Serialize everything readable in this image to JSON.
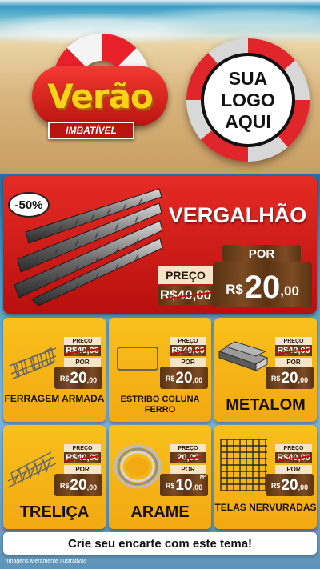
{
  "header": {
    "badge_title": "Verão",
    "badge_subtitle": "IMBATÍVEL",
    "logo_lines": [
      "SUA",
      "LOGO",
      "AQUI"
    ]
  },
  "featured": {
    "discount": "-50%",
    "name": "VERGALHÃO",
    "old_label": "PREÇO",
    "old_price": "R$40,00",
    "new_label": "POR",
    "currency": "R$",
    "price_int": "20",
    "price_dec": ",00"
  },
  "products": [
    {
      "name": "FERRAGEM ARMADA",
      "old_label": "PREÇO",
      "old_price": "R$40,00",
      "new_label": "POR",
      "currency": "R$",
      "price_int": "20",
      "price_dec": ",00",
      "unit": ""
    },
    {
      "name": "ESTRIBO COLUNA FERRO",
      "old_label": "PREÇO",
      "old_price": "R$40,00",
      "new_label": "POR",
      "currency": "R$",
      "price_int": "20",
      "price_dec": ",00",
      "unit": ""
    },
    {
      "name": "METALOM",
      "old_label": "PREÇO",
      "old_price": "R$40,00",
      "new_label": "POR",
      "currency": "R$",
      "price_int": "20",
      "price_dec": ",00",
      "unit": ""
    },
    {
      "name": "TRELIÇA",
      "old_label": "PREÇO",
      "old_price": "R$40,00",
      "new_label": "POR",
      "currency": "R$",
      "price_int": "20",
      "price_dec": ",00",
      "unit": ""
    },
    {
      "name": "ARAME",
      "old_label": "PREÇO",
      "old_price": "20,00",
      "new_label": "POR",
      "currency": "R$",
      "price_int": "10",
      "price_dec": ",00",
      "unit": "M²"
    },
    {
      "name": "TELAS NERVURADAS",
      "old_label": "PREÇO",
      "old_price": "R$40,00",
      "new_label": "POR",
      "currency": "R$",
      "price_int": "20",
      "price_dec": ",00",
      "unit": ""
    }
  ],
  "footer": {
    "cta": "Crie seu encarte com este tema!",
    "note": "*Imagens Meramente Ilustrativas"
  }
}
